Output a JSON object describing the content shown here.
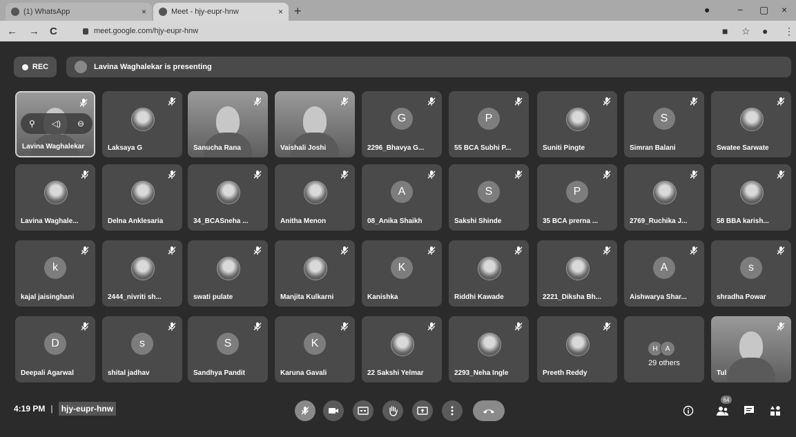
{
  "browser": {
    "tabs": [
      {
        "title": "(1) WhatsApp",
        "close": "×"
      },
      {
        "title": "Meet - hjy-eupr-hnw",
        "close": "×"
      }
    ],
    "new_tab": "+",
    "url": "meet.google.com/hjy-eupr-hnw",
    "nav": {
      "back": "←",
      "forward": "→",
      "reload": "C"
    },
    "window": {
      "minimize": "−",
      "maximize": "▢",
      "close": "×"
    }
  },
  "meet": {
    "rec_label": "REC",
    "presenting": "Lavina Waghalekar is presenting",
    "participants": [
      {
        "name": "Lavina Waghalekar",
        "type": "self"
      },
      {
        "name": "Laksaya G",
        "type": "photo"
      },
      {
        "name": "Sanucha Rana",
        "type": "video"
      },
      {
        "name": "Vaishali Joshi",
        "type": "video"
      },
      {
        "name": "2296_Bhavya G...",
        "type": "letter",
        "initial": "G"
      },
      {
        "name": "55 BCA Subhi P...",
        "type": "letter",
        "initial": "P"
      },
      {
        "name": "Suniti Pingte",
        "type": "photo"
      },
      {
        "name": "Simran Balani",
        "type": "letter",
        "initial": "S"
      },
      {
        "name": "Swatee Sarwate",
        "type": "photo"
      },
      {
        "name": "Lavina Waghale...",
        "type": "photo"
      },
      {
        "name": "Delna Anklesaria",
        "type": "photo"
      },
      {
        "name": "34_BCASneha ...",
        "type": "photo"
      },
      {
        "name": "Anitha Menon",
        "type": "photo"
      },
      {
        "name": "08_Anika Shaikh",
        "type": "letter",
        "initial": "A"
      },
      {
        "name": "Sakshi Shinde",
        "type": "letter",
        "initial": "S"
      },
      {
        "name": "35 BCA prerna ...",
        "type": "letter",
        "initial": "P"
      },
      {
        "name": "2769_Ruchika J...",
        "type": "photo"
      },
      {
        "name": "58 BBA karish...",
        "type": "photo"
      },
      {
        "name": "kajal jaisinghani",
        "type": "letter",
        "initial": "k"
      },
      {
        "name": "2444_nivriti sh...",
        "type": "photo"
      },
      {
        "name": "swati pulate",
        "type": "photo"
      },
      {
        "name": "Manjita Kulkarni",
        "type": "photo"
      },
      {
        "name": "Kanishka",
        "type": "letter",
        "initial": "K"
      },
      {
        "name": "Riddhi Kawade",
        "type": "photo"
      },
      {
        "name": "2221_Diksha Bh...",
        "type": "photo"
      },
      {
        "name": "Aishwarya Shar...",
        "type": "letter",
        "initial": "A"
      },
      {
        "name": "shradha Powar",
        "type": "letter",
        "initial": "s"
      },
      {
        "name": "Deepali Agarwal",
        "type": "letter",
        "initial": "D"
      },
      {
        "name": "shital jadhav",
        "type": "letter",
        "initial": "s"
      },
      {
        "name": "Sandhya Pandit",
        "type": "letter",
        "initial": "S"
      },
      {
        "name": "Karuna Gavali",
        "type": "letter",
        "initial": "K"
      },
      {
        "name": "22 Sakshi Yelmar",
        "type": "photo"
      },
      {
        "name": "2293_Neha Ingle",
        "type": "photo"
      },
      {
        "name": "Preeth Reddy",
        "type": "photo"
      },
      {
        "name": "29 others",
        "type": "others",
        "initials": [
          "H",
          "A"
        ]
      },
      {
        "name": "Tul",
        "type": "video"
      }
    ],
    "time": "4:19 PM",
    "separator": "|",
    "meeting_code": "hjy-eupr-hnw",
    "participant_count": "64"
  }
}
